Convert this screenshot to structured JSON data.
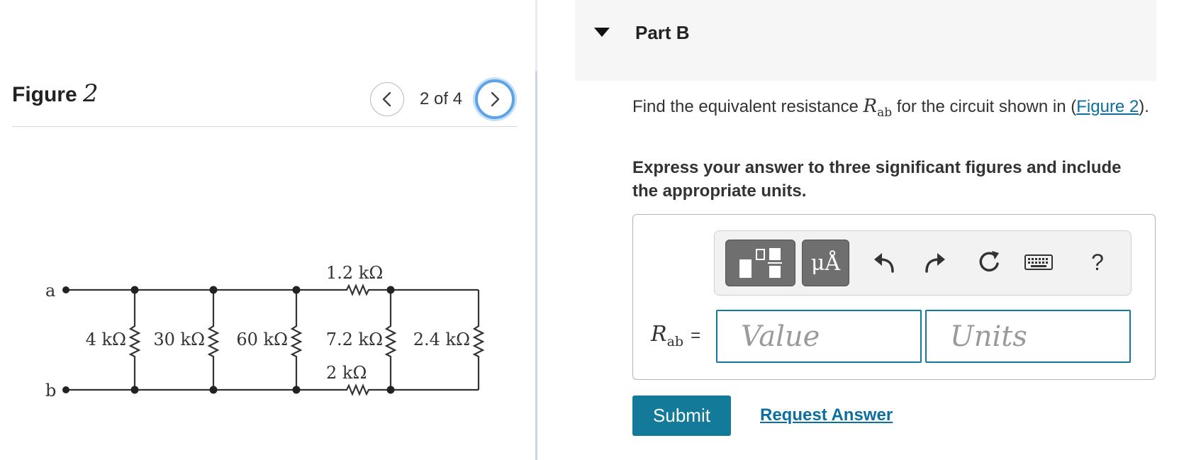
{
  "figure": {
    "title_word": "Figure",
    "title_number": "2",
    "counter": "2 of 4",
    "prev_icon": "chevron-left-icon",
    "next_icon": "chevron-right-icon"
  },
  "circuit": {
    "node_a": "a",
    "node_b": "b",
    "r_top": "1.2 kΩ",
    "r_bottom": "2 kΩ",
    "r1": "4 kΩ",
    "r2": "30 kΩ",
    "r3": "60 kΩ",
    "r4": "7.2 kΩ",
    "r5": "2.4 kΩ"
  },
  "part": {
    "toggle_icon": "caret-down-icon",
    "title": "Part B"
  },
  "question": {
    "text_before": "Find the equivalent resistance ",
    "symbol": "R",
    "symbol_sub": "ab",
    "text_after": " for the circuit shown in (",
    "link": "Figure 2",
    "text_end": ")."
  },
  "instructions": "Express your answer to three significant figures and include the appropriate units.",
  "toolbar": {
    "template_icon": "fraction-template-icon",
    "units_label": "μÅ",
    "undo_icon": "undo-icon",
    "redo_icon": "redo-icon",
    "reset_icon": "reset-icon",
    "keyboard_icon": "keyboard-icon",
    "help_label": "?"
  },
  "answer": {
    "label_symbol": "R",
    "label_sub": "ab",
    "label_eq": "=",
    "value_placeholder": "Value",
    "units_placeholder": "Units",
    "value": "",
    "units": ""
  },
  "actions": {
    "submit": "Submit",
    "request": "Request Answer"
  },
  "colors": {
    "accent": "#137a9a",
    "link": "#0c6f9e",
    "focus_ring": "#5ea2e8"
  }
}
